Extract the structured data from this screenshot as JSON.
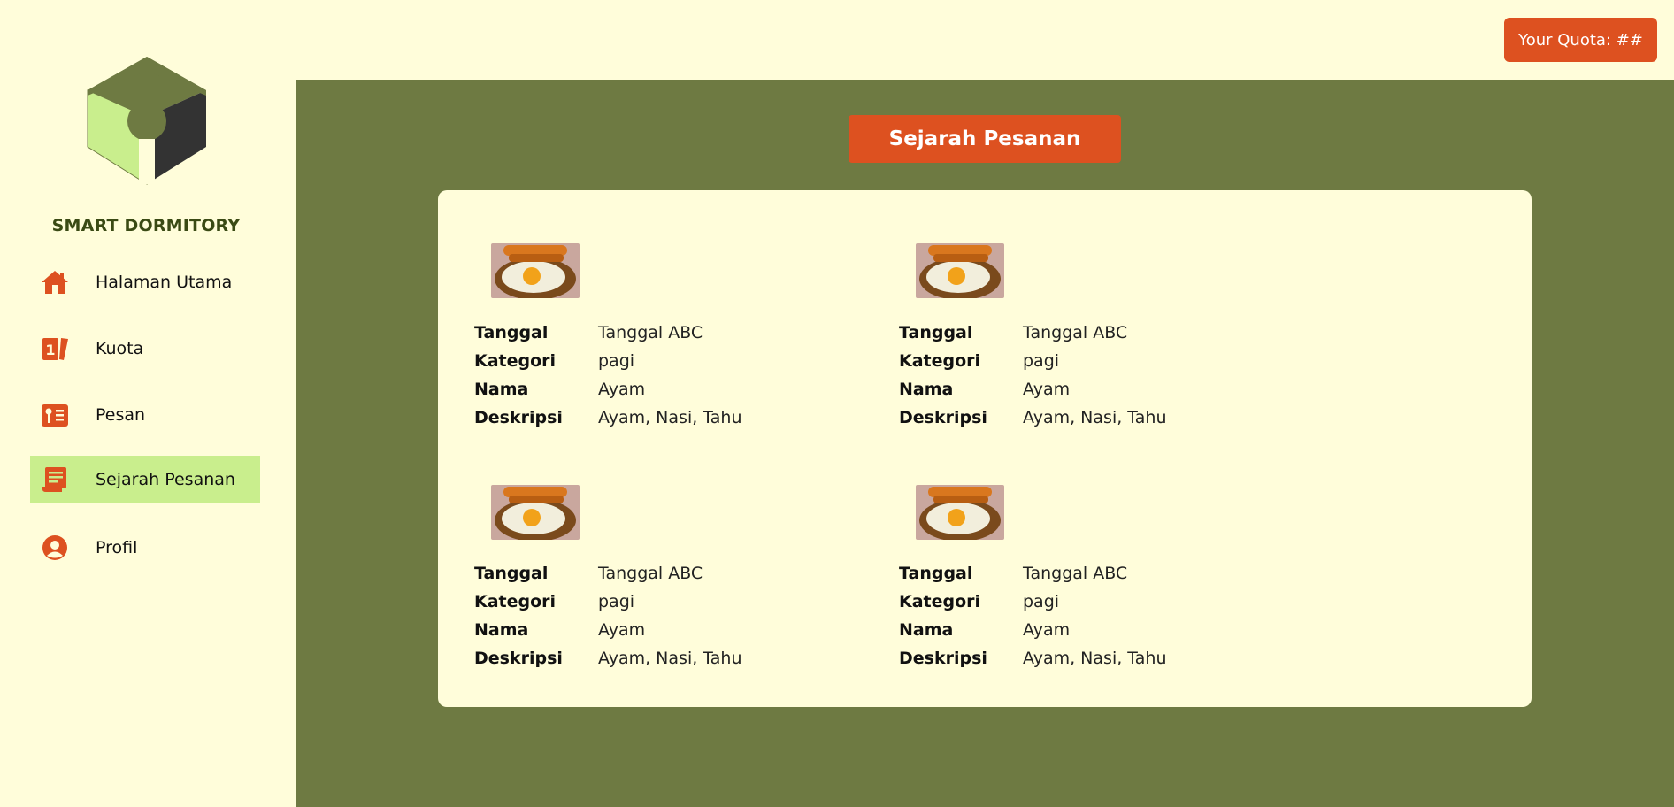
{
  "app": {
    "brand": "SMART DORMITORY",
    "colors": {
      "accent": "#DD5120",
      "main_bg": "#6E7A42",
      "panel_bg": "#FFFDDA",
      "active_nav": "#C9EE8D"
    }
  },
  "header": {
    "quota_label": "Your Quota: ##"
  },
  "sidebar": {
    "items": [
      {
        "label": "Halaman Utama",
        "icon": "home-icon",
        "active": false
      },
      {
        "label": "Kuota",
        "icon": "quota-card-icon",
        "active": false
      },
      {
        "label": "Pesan",
        "icon": "order-menu-icon",
        "active": false
      },
      {
        "label": "Sejarah Pesanan",
        "icon": "order-history-icon",
        "active": true
      },
      {
        "label": "Profil",
        "icon": "profile-icon",
        "active": false
      }
    ]
  },
  "main": {
    "title": "Sejarah Pesanan",
    "labels": {
      "date": "Tanggal",
      "category": "Kategori",
      "name": "Nama",
      "description": "Deskripsi"
    },
    "orders": [
      {
        "image": "fried-egg-rice-image",
        "date": "Tanggal ABC",
        "category": "pagi",
        "name": "Ayam",
        "description": "Ayam, Nasi, Tahu"
      },
      {
        "image": "fried-egg-rice-image",
        "date": "Tanggal ABC",
        "category": "pagi",
        "name": "Ayam",
        "description": "Ayam, Nasi, Tahu"
      },
      {
        "image": "fried-egg-rice-image",
        "date": "Tanggal ABC",
        "category": "pagi",
        "name": "Ayam",
        "description": "Ayam, Nasi, Tahu"
      },
      {
        "image": "fried-egg-rice-image",
        "date": "Tanggal ABC",
        "category": "pagi",
        "name": "Ayam",
        "description": "Ayam, Nasi, Tahu"
      }
    ]
  }
}
